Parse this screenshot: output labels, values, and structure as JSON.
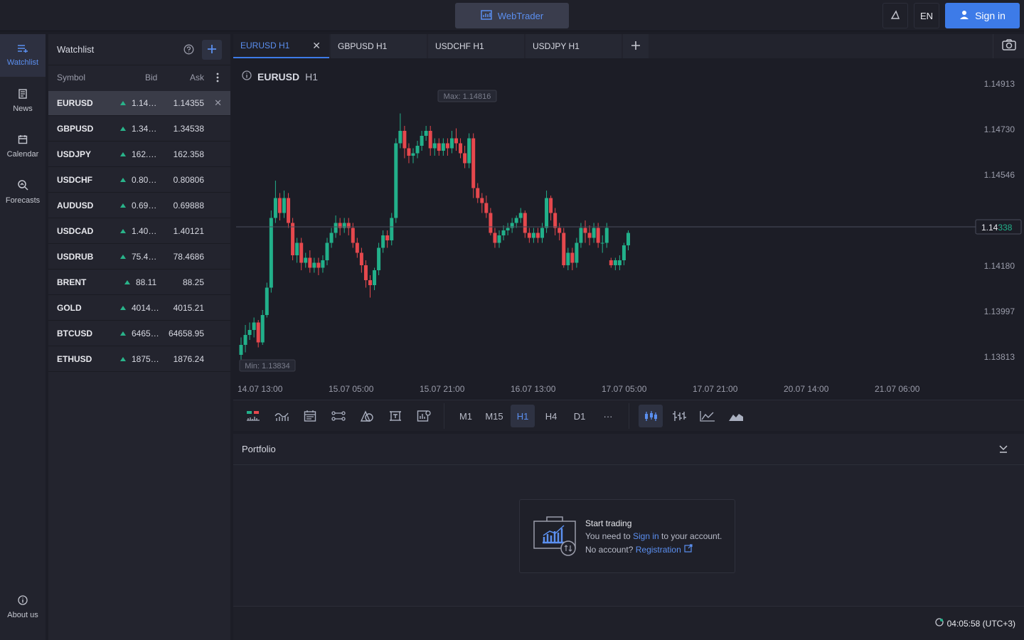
{
  "header": {
    "webtrader_label": "WebTrader",
    "lang": "EN",
    "signin_label": "Sign in"
  },
  "nav": {
    "items": [
      {
        "label": "Watchlist",
        "icon": "watchlist-icon"
      },
      {
        "label": "News",
        "icon": "news-icon"
      },
      {
        "label": "Calendar",
        "icon": "calendar-icon"
      },
      {
        "label": "Forecasts",
        "icon": "forecasts-icon"
      }
    ],
    "about_label": "About us"
  },
  "watchlist": {
    "title": "Watchlist",
    "columns": {
      "symbol": "Symbol",
      "bid": "Bid",
      "ask": "Ask"
    },
    "rows": [
      {
        "symbol": "EURUSD",
        "bid": "1.14…",
        "ask": "1.14355"
      },
      {
        "symbol": "GBPUSD",
        "bid": "1.34…",
        "ask": "1.34538"
      },
      {
        "symbol": "USDJPY",
        "bid": "162.…",
        "ask": "162.358"
      },
      {
        "symbol": "USDCHF",
        "bid": "0.80…",
        "ask": "0.80806"
      },
      {
        "symbol": "AUDUSD",
        "bid": "0.69…",
        "ask": "0.69888"
      },
      {
        "symbol": "USDCAD",
        "bid": "1.40…",
        "ask": "1.40121"
      },
      {
        "symbol": "USDRUB",
        "bid": "75.4…",
        "ask": "78.4686"
      },
      {
        "symbol": "BRENT",
        "bid": "88.11",
        "ask": "88.25"
      },
      {
        "symbol": "GOLD",
        "bid": "4014…",
        "ask": "4015.21"
      },
      {
        "symbol": "BTCUSD",
        "bid": "6465…",
        "ask": "64658.95"
      },
      {
        "symbol": "ETHUSD",
        "bid": "1875…",
        "ask": "1876.24"
      }
    ]
  },
  "tabs": [
    "EURUSD H1",
    "GBPUSD H1",
    "USDCHF H1",
    "USDJPY H1"
  ],
  "chart_title": {
    "symbol": "EURUSD",
    "tf": "H1"
  },
  "chart_data": {
    "type": "candlestick",
    "max_label": "Max: 1.14816",
    "min_label": "Min: 1.13834",
    "price_ticks": [
      "1.14913",
      "1.14730",
      "1.14546",
      "1.14180",
      "1.13997",
      "1.13813"
    ],
    "current_price": {
      "main": "1.14",
      "hl": "338"
    },
    "x_ticks": [
      "14.07 13:00",
      "15.07 05:00",
      "15.07 21:00",
      "16.07 13:00",
      "17.07 05:00",
      "17.07 21:00",
      "20.07 14:00",
      "21.07 06:00"
    ],
    "ylim": [
      1.1375,
      1.1495
    ],
    "candles": [
      [
        1.1385,
        1.1389,
        1.1383,
        1.1392
      ],
      [
        1.1389,
        1.1393,
        1.1386,
        1.1397
      ],
      [
        1.1393,
        1.1395,
        1.1391,
        1.1398
      ],
      [
        1.1395,
        1.1398,
        1.1392,
        1.14
      ],
      [
        1.1398,
        1.139,
        1.1388,
        1.1399
      ],
      [
        1.139,
        1.1401,
        1.1389,
        1.1403
      ],
      [
        1.1401,
        1.1412,
        1.14,
        1.1414
      ],
      [
        1.1412,
        1.144,
        1.141,
        1.1443
      ],
      [
        1.144,
        1.1448,
        1.1438,
        1.1455
      ],
      [
        1.1448,
        1.1442,
        1.1439,
        1.145
      ],
      [
        1.1442,
        1.1448,
        1.144,
        1.1451
      ],
      [
        1.1448,
        1.1438,
        1.1436,
        1.145
      ],
      [
        1.1438,
        1.1425,
        1.1423,
        1.144
      ],
      [
        1.1425,
        1.143,
        1.1422,
        1.1432
      ],
      [
        1.143,
        1.1422,
        1.1419,
        1.1432
      ],
      [
        1.1422,
        1.1424,
        1.142,
        1.1426
      ],
      [
        1.1424,
        1.142,
        1.1418,
        1.1427
      ],
      [
        1.142,
        1.1422,
        1.1418,
        1.1424
      ],
      [
        1.1422,
        1.142,
        1.1417,
        1.1424
      ],
      [
        1.142,
        1.1423,
        1.1418,
        1.1425
      ],
      [
        1.1423,
        1.143,
        1.1421,
        1.1432
      ],
      [
        1.143,
        1.1434,
        1.1428,
        1.1436
      ],
      [
        1.1434,
        1.1438,
        1.1432,
        1.1441
      ],
      [
        1.1438,
        1.1436,
        1.1433,
        1.144
      ],
      [
        1.1436,
        1.1438,
        1.1434,
        1.144
      ],
      [
        1.1438,
        1.1436,
        1.1433,
        1.144
      ],
      [
        1.1436,
        1.143,
        1.1428,
        1.1438
      ],
      [
        1.143,
        1.1426,
        1.1424,
        1.1432
      ],
      [
        1.1426,
        1.1421,
        1.1418,
        1.1428
      ],
      [
        1.1421,
        1.1415,
        1.1412,
        1.1423
      ],
      [
        1.1415,
        1.1413,
        1.1408,
        1.1417
      ],
      [
        1.1413,
        1.1419,
        1.1411,
        1.142
      ],
      [
        1.1419,
        1.1428,
        1.1417,
        1.143
      ],
      [
        1.1428,
        1.1433,
        1.1426,
        1.1435
      ],
      [
        1.1433,
        1.1431,
        1.1428,
        1.1435
      ],
      [
        1.1431,
        1.144,
        1.1429,
        1.1442
      ],
      [
        1.144,
        1.147,
        1.1438,
        1.1472
      ],
      [
        1.147,
        1.1475,
        1.1468,
        1.1482
      ],
      [
        1.1475,
        1.1468,
        1.1464,
        1.1477
      ],
      [
        1.1468,
        1.1465,
        1.1462,
        1.147
      ],
      [
        1.1465,
        1.1466,
        1.1462,
        1.1468
      ],
      [
        1.1466,
        1.1469,
        1.1464,
        1.1471
      ],
      [
        1.1469,
        1.1473,
        1.1467,
        1.1475
      ],
      [
        1.1473,
        1.1475,
        1.1471,
        1.1477
      ],
      [
        1.1475,
        1.1468,
        1.1465,
        1.1477
      ],
      [
        1.1468,
        1.147,
        1.1465,
        1.1472
      ],
      [
        1.147,
        1.1467,
        1.1465,
        1.1472
      ],
      [
        1.1467,
        1.147,
        1.1465,
        1.1472
      ],
      [
        1.147,
        1.1468,
        1.1465,
        1.1472
      ],
      [
        1.1468,
        1.1472,
        1.1466,
        1.1475
      ],
      [
        1.1472,
        1.147,
        1.1467,
        1.1476
      ],
      [
        1.147,
        1.1466,
        1.1464,
        1.1472
      ],
      [
        1.1466,
        1.1462,
        1.146,
        1.1469
      ],
      [
        1.1462,
        1.1472,
        1.146,
        1.1474
      ],
      [
        1.1472,
        1.1452,
        1.1448,
        1.1474
      ],
      [
        1.1452,
        1.1448,
        1.1446,
        1.1454
      ],
      [
        1.1448,
        1.1446,
        1.1442,
        1.145
      ],
      [
        1.1446,
        1.1442,
        1.144,
        1.1449
      ],
      [
        1.1442,
        1.1434,
        1.1433,
        1.1444
      ],
      [
        1.1434,
        1.143,
        1.1428,
        1.1436
      ],
      [
        1.143,
        1.1433,
        1.1428,
        1.1435
      ],
      [
        1.1433,
        1.1435,
        1.1431,
        1.1437
      ],
      [
        1.1435,
        1.1436,
        1.1433,
        1.1438
      ],
      [
        1.1436,
        1.1438,
        1.1434,
        1.144
      ],
      [
        1.1438,
        1.144,
        1.1436,
        1.1441
      ],
      [
        1.144,
        1.1442,
        1.1438,
        1.1444
      ],
      [
        1.1442,
        1.1434,
        1.1432,
        1.1443
      ],
      [
        1.1434,
        1.1432,
        1.143,
        1.1436
      ],
      [
        1.1432,
        1.1434,
        1.143,
        1.1436
      ],
      [
        1.1434,
        1.1432,
        1.143,
        1.1436
      ],
      [
        1.1432,
        1.1436,
        1.143,
        1.1438
      ],
      [
        1.1436,
        1.1448,
        1.1434,
        1.1451
      ],
      [
        1.1448,
        1.1442,
        1.1439,
        1.1449
      ],
      [
        1.1442,
        1.1436,
        1.1433,
        1.1444
      ],
      [
        1.1436,
        1.1434,
        1.1431,
        1.1438
      ],
      [
        1.1434,
        1.1421,
        1.142,
        1.1436
      ],
      [
        1.1421,
        1.1426,
        1.1419,
        1.1428
      ],
      [
        1.1426,
        1.1422,
        1.1419,
        1.1428
      ],
      [
        1.1422,
        1.143,
        1.142,
        1.1432
      ],
      [
        1.143,
        1.1436,
        1.1428,
        1.1438
      ],
      [
        1.1436,
        1.1434,
        1.143,
        1.1439
      ],
      [
        1.1434,
        1.1432,
        1.1429,
        1.1437
      ],
      [
        1.1432,
        1.1436,
        1.143,
        1.1438
      ],
      [
        1.1436,
        1.143,
        1.1428,
        1.1438
      ],
      [
        1.143,
        1.143,
        1.1426,
        1.1433
      ],
      [
        1.143,
        1.1436,
        1.1428,
        1.1438
      ],
      [
        1.1423,
        1.1421,
        1.142,
        1.1424
      ],
      [
        1.1421,
        1.1423,
        1.1419,
        1.1424
      ],
      [
        1.1421,
        1.1423,
        1.1419,
        1.1425
      ],
      [
        1.1423,
        1.1429,
        1.1421,
        1.143
      ],
      [
        1.1429,
        1.1434,
        1.1427,
        1.1435
      ]
    ],
    "colors": {
      "up": "#22b08a",
      "down": "#e5484d"
    }
  },
  "timeframes": [
    "M1",
    "M15",
    "H1",
    "H4",
    "D1",
    "···"
  ],
  "active_timeframe": "H1",
  "portfolio": {
    "title": "Portfolio",
    "card_title": "Start trading",
    "line1_pre": "You need to ",
    "line1_link": "Sign in",
    "line1_post": " to your account.",
    "line2_pre": "No account? ",
    "line2_link": "Registration"
  },
  "status": {
    "time": "04:05:58 (UTC+3)"
  }
}
